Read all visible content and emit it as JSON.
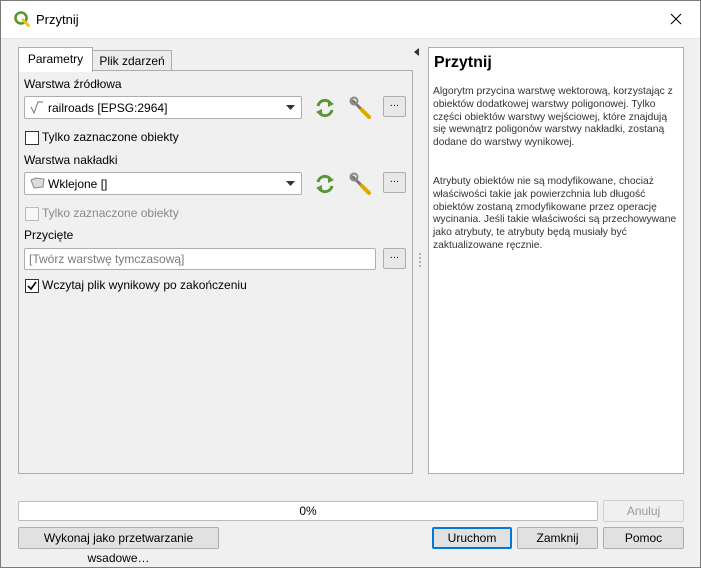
{
  "window": {
    "title": "Przytnij",
    "close_glyph": "✕"
  },
  "tabs": [
    {
      "label": "Parametry",
      "active": true
    },
    {
      "label": "Plik zdarzeń",
      "active": false
    }
  ],
  "params": {
    "source_layer_label": "Warstwa źródłowa",
    "source_layer_value": "railroads [EPSG:2964]",
    "source_selected_only": "Tylko zaznaczone obiekty",
    "overlay_layer_label": "Warstwa nakładki",
    "overlay_layer_value": "Wklejone []",
    "overlay_selected_only": "Tylko zaznaczone obiekty",
    "clipped_label": "Przycięte",
    "clipped_placeholder": "[Twórz warstwę tymczasową]",
    "load_result": "Wczytaj plik wynikowy po zakończeniu",
    "dots": "…"
  },
  "help": {
    "title": "Przytnij",
    "paragraph1": "Algorytm przycina warstwę wektorową, korzystając z obiektów dodatkowej warstwy poligonowej. Tylko części obiektów warstwy wejściowej, które znajdują się wewnątrz poligonów warstwy nakładki, zostaną dodane do warstwy wynikowej.",
    "paragraph2": "Atrybuty obiektów nie są modyfikowane, chociaż właściwości takie jak powierzchnia lub długość obiektów zostaną zmodyfikowane przez operację wycinania. Jeśli takie właściwości są przechowywane jako atrybuty, te atrybuty będą musiały być zaktualizowane ręcznie."
  },
  "progress": {
    "text": "0%",
    "value": 0
  },
  "buttons": {
    "cancel": "Anuluj",
    "batch": "Wykonaj jako przetwarzanie wsadowe…",
    "run": "Uruchom",
    "close": "Zamknij",
    "help": "Pomoc"
  },
  "colors": {
    "accent": "#0078d7",
    "qgis_green": "#589632",
    "qgis_yellow": "#f0c419"
  }
}
